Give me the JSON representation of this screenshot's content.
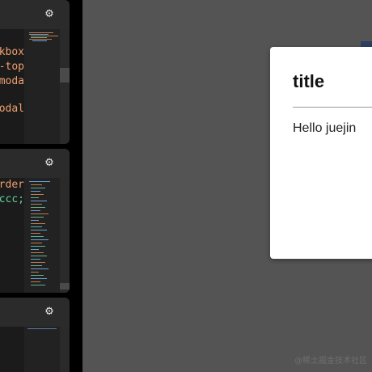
{
  "editor_panels": [
    {
      "settings_icon": "gear-icon",
      "code_lines": [
        {
          "text": "kbox",
          "color": "#f0a070"
        },
        {
          "text": "-top",
          "color": "#f0a070"
        },
        {
          "text": "moda",
          "color": "#f0a070"
        },
        {
          "text": "",
          "color": "#f0a070"
        },
        {
          "text": "odal",
          "color": "#f0a070"
        }
      ]
    },
    {
      "settings_icon": "gear-icon",
      "code_lines": [
        {
          "text": "order",
          "color": "#f0a070"
        },
        {
          "text": "#ccc;",
          "color": "#5fd0a0"
        }
      ]
    },
    {
      "settings_icon": "gear-icon",
      "code_lines": []
    }
  ],
  "preview": {
    "background": "#545454",
    "modal": {
      "title": "title",
      "body": "Hello juejin"
    },
    "watermark": "@稀土掘金技术社区"
  }
}
